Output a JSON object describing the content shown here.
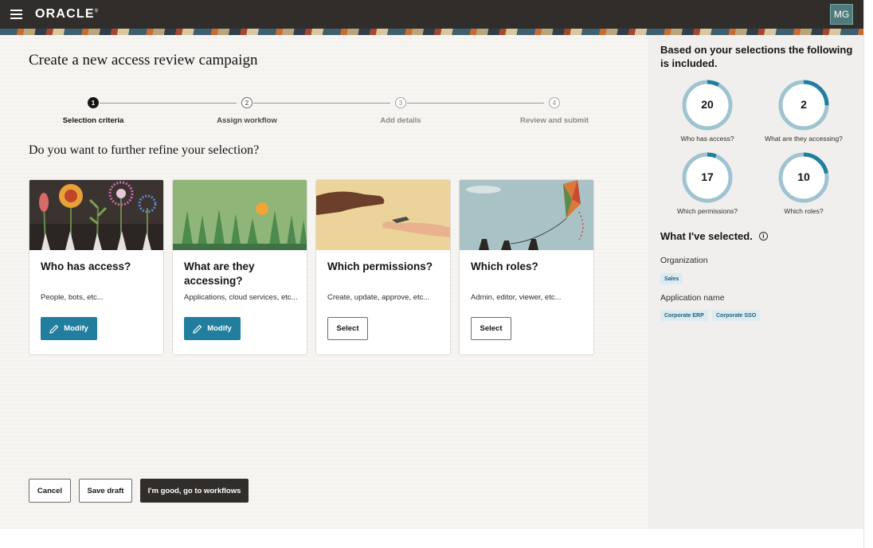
{
  "header": {
    "brand": "ORACLE",
    "user_initials": "MG"
  },
  "page": {
    "title": "Create a new access review campaign",
    "question": "Do you want to further refine your selection?"
  },
  "stepper": {
    "steps": [
      {
        "number": "1",
        "label": "Selection criteria",
        "state": "active"
      },
      {
        "number": "2",
        "label": "Assign workflow",
        "state": "upcoming"
      },
      {
        "number": "3",
        "label": "Add details",
        "state": "disabled"
      },
      {
        "number": "4",
        "label": "Review and submit",
        "state": "disabled"
      }
    ]
  },
  "cards": [
    {
      "title": "Who has access?",
      "description": "People, bots, etc...",
      "button": "Modify",
      "button_type": "primary"
    },
    {
      "title": "What are they accessing?",
      "description": "Applications, cloud services, etc...",
      "button": "Modify",
      "button_type": "primary"
    },
    {
      "title": "Which permissions?",
      "description": "Create, update, approve, etc...",
      "button": "Select",
      "button_type": "outline"
    },
    {
      "title": "Which roles?",
      "description": "Admin, editor, viewer, etc...",
      "button": "Select",
      "button_type": "outline"
    }
  ],
  "footer": {
    "cancel": "Cancel",
    "save_draft": "Save draft",
    "continue": "I'm good, go to workflows"
  },
  "summary": {
    "heading": "Based on your selections the following is included.",
    "metrics": [
      {
        "value": "20",
        "label": "Who has access?",
        "fill_fraction": 0.08
      },
      {
        "value": "2",
        "label": "What are they accessing?",
        "fill_fraction": 0.25
      },
      {
        "value": "17",
        "label": "Which permissions?",
        "fill_fraction": 0.06
      },
      {
        "value": "10",
        "label": "Which roles?",
        "fill_fraction": 0.22
      }
    ],
    "ring_color": "#227e9e",
    "ring_track_color": "#9fc3d1"
  },
  "selected": {
    "title": "What I've selected.",
    "groups": [
      {
        "label": "Organization",
        "chips": [
          "Sales"
        ]
      },
      {
        "label": "Application name",
        "chips": [
          "Corporate ERP",
          "Corporate SSO"
        ]
      }
    ]
  },
  "colors": {
    "primary": "#227e9e",
    "header_bg": "#312d2a",
    "chip_bg": "#dcebf1"
  }
}
